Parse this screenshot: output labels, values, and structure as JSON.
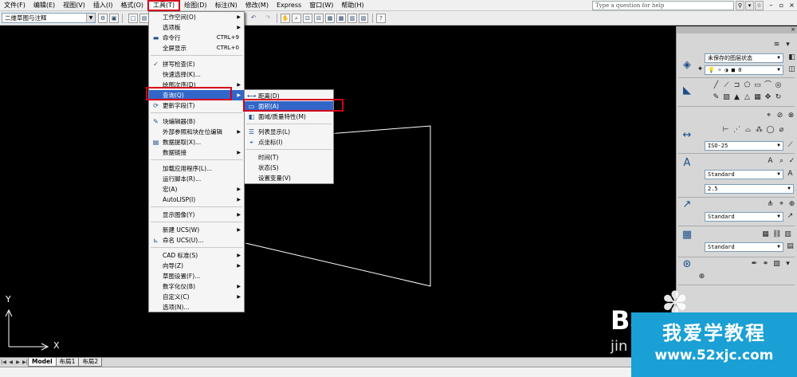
{
  "menubar": {
    "items": [
      {
        "label": "文件(F)"
      },
      {
        "label": "编辑(E)"
      },
      {
        "label": "视图(V)"
      },
      {
        "label": "插入(I)"
      },
      {
        "label": "格式(O)"
      },
      {
        "label": "工具(T)"
      },
      {
        "label": "绘图(D)"
      },
      {
        "label": "标注(N)"
      },
      {
        "label": "修改(M)"
      },
      {
        "label": "Express"
      },
      {
        "label": "窗口(W)"
      },
      {
        "label": "帮助(H)"
      }
    ],
    "active_index": 5,
    "help_placeholder": "Type a question for help"
  },
  "toolbar": {
    "workspace": "二维草图与注释"
  },
  "tools_menu": {
    "items": [
      {
        "label": "工作空间(O)",
        "shortcut": "",
        "submenu": true
      },
      {
        "label": "选项板",
        "shortcut": "",
        "submenu": true
      },
      {
        "label": "命令行",
        "shortcut": "CTRL+9",
        "submenu": false
      },
      {
        "label": "全屏显示",
        "shortcut": "CTRL+0",
        "submenu": false
      },
      {
        "label": "拼写检查(E)",
        "shortcut": "",
        "submenu": false
      },
      {
        "label": "快速选择(K)...",
        "shortcut": "",
        "submenu": false
      },
      {
        "label": "绘图次序(D)",
        "shortcut": "",
        "submenu": true
      },
      {
        "label": "查询(Q)",
        "shortcut": "",
        "submenu": true
      },
      {
        "label": "更新字段(T)",
        "shortcut": "",
        "submenu": false
      },
      {
        "label": "块编辑器(B)",
        "shortcut": "",
        "submenu": false
      },
      {
        "label": "外部参照和块在位编辑",
        "shortcut": "",
        "submenu": true
      },
      {
        "label": "数据提取(X)...",
        "shortcut": "",
        "submenu": false
      },
      {
        "label": "数据链接",
        "shortcut": "",
        "submenu": true
      },
      {
        "label": "加载应用程序(L)...",
        "shortcut": "",
        "submenu": false
      },
      {
        "label": "运行脚本(R)...",
        "shortcut": "",
        "submenu": false
      },
      {
        "label": "宏(A)",
        "shortcut": "",
        "submenu": true
      },
      {
        "label": "AutoLISP(I)",
        "shortcut": "",
        "submenu": true
      },
      {
        "label": "显示图像(Y)",
        "shortcut": "",
        "submenu": true
      },
      {
        "label": "新建 UCS(W)",
        "shortcut": "",
        "submenu": true
      },
      {
        "label": "命名 UCS(U)...",
        "shortcut": "",
        "submenu": false
      },
      {
        "label": "CAD 标准(S)",
        "shortcut": "",
        "submenu": true
      },
      {
        "label": "向导(Z)",
        "shortcut": "",
        "submenu": true
      },
      {
        "label": "草图设置(F)...",
        "shortcut": "",
        "submenu": false
      },
      {
        "label": "数字化仪(B)",
        "shortcut": "",
        "submenu": true
      },
      {
        "label": "自定义(C)",
        "shortcut": "",
        "submenu": true
      },
      {
        "label": "选项(N)...",
        "shortcut": "",
        "submenu": false
      }
    ]
  },
  "inquiry_menu": {
    "items": [
      {
        "label": "距离(D)"
      },
      {
        "label": "面积(A)"
      },
      {
        "label": "面域/质量特性(M)"
      },
      {
        "label": "列表显示(L)"
      },
      {
        "label": "点坐标(I)"
      },
      {
        "label": "时间(T)"
      },
      {
        "label": "状态(S)"
      },
      {
        "label": "设置变量(V)"
      }
    ]
  },
  "canvas": {
    "ucs_x": "X",
    "ucs_y": "Y"
  },
  "tabs": [
    {
      "label": "Model"
    },
    {
      "label": "布局1"
    },
    {
      "label": "布局2"
    }
  ],
  "palette": {
    "layer_state": "未保存的图层状态",
    "layer_current": "0",
    "dim_style": "ISO-25",
    "text_style": "Standard",
    "text_height": "2.5",
    "mleader_style": "Standard",
    "table_style": "Standard"
  },
  "watermark": {
    "title": "我爱学教程",
    "url": "www.52xjc.com",
    "b_text": "Ba",
    "jin_text": "jin"
  },
  "colors": {
    "highlight": "#3166c8",
    "annotation_red": "#d4001a",
    "watermark_blue": "#1aa0d4"
  }
}
